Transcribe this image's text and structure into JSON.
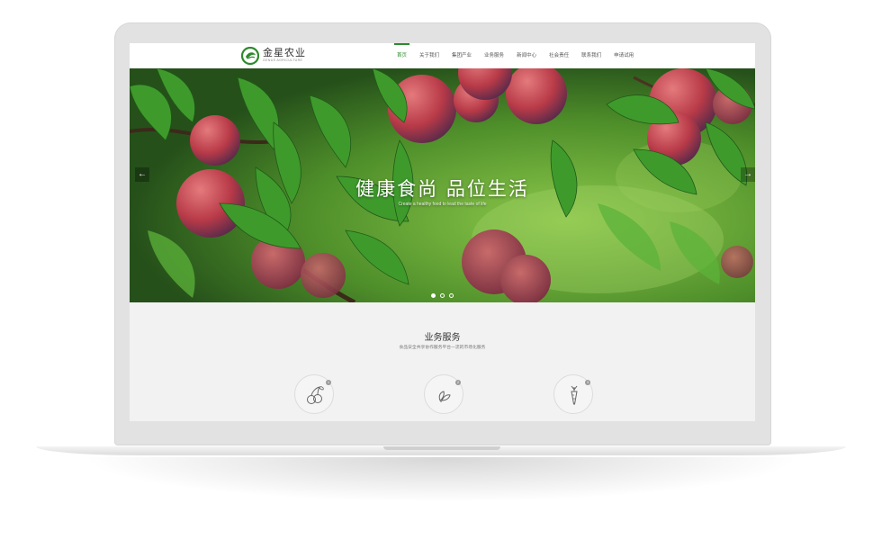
{
  "site": {
    "logo": {
      "name": "金星农业",
      "subtitle": "GENUS AGRICULTURE"
    },
    "nav": [
      {
        "label": "首页",
        "active": true
      },
      {
        "label": "关于我们",
        "active": false
      },
      {
        "label": "集团产业",
        "active": false
      },
      {
        "label": "业务服务",
        "active": false
      },
      {
        "label": "新闻中心",
        "active": false
      },
      {
        "label": "社会责任",
        "active": false
      },
      {
        "label": "联系我们",
        "active": false
      },
      {
        "label": "申请试用",
        "active": false
      }
    ]
  },
  "hero": {
    "title": "健康食尚 品位生活",
    "subtitle": "Create a healthy food to lead the taste of life",
    "slide_count": 3,
    "active_slide": 1
  },
  "services": {
    "title": "业务服务",
    "subtitle": "食品安全共享协作服务平台一流的市场化服务",
    "items": [
      {
        "icon": "cherry-icon",
        "number": "1"
      },
      {
        "icon": "leaf-icon",
        "number": "2"
      },
      {
        "icon": "carrot-icon",
        "number": "3"
      }
    ]
  },
  "colors": {
    "brand_green": "#2d8a2d",
    "section_bg": "#f2f2f2"
  }
}
